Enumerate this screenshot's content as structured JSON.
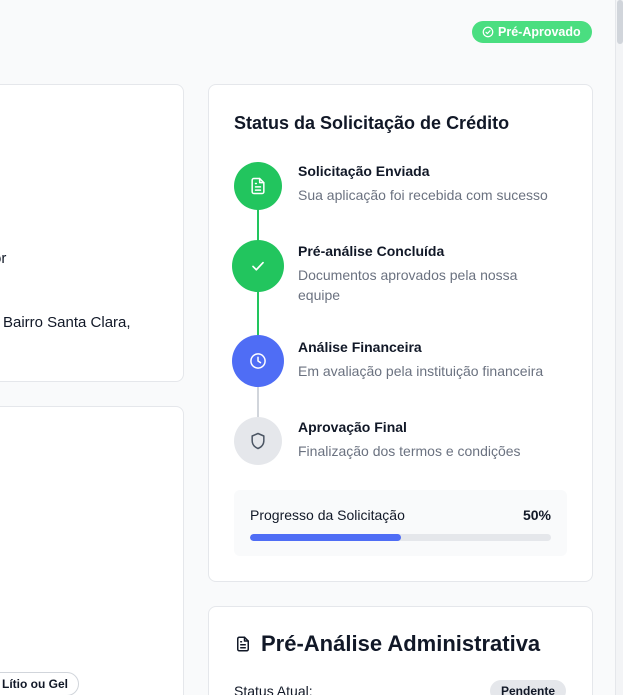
{
  "header": {
    "badge_label": "Pré-Aprovado"
  },
  "left_panel": {
    "fragment_1": "or",
    "fragment_2": "Bairro Santa Clara,",
    "chip_label": "Lítio ou Gel"
  },
  "status_card": {
    "title": "Status da Solicitação de Crédito",
    "steps": [
      {
        "title": "Solicitação Enviada",
        "description": "Sua aplicação foi recebida com sucesso",
        "state": "complete",
        "icon": "document-icon"
      },
      {
        "title": "Pré-análise Concluída",
        "description": "Documentos aprovados pela nossa equipe",
        "state": "complete",
        "icon": "check-icon"
      },
      {
        "title": "Análise Financeira",
        "description": "Em avaliação pela instituição financeira",
        "state": "current",
        "icon": "clock-icon"
      },
      {
        "title": "Aprovação Final",
        "description": "Finalização dos termos e condições",
        "state": "pending",
        "icon": "shield-icon"
      }
    ],
    "progress": {
      "label": "Progresso da Solicitação",
      "value_text": "50%",
      "fraction": 0.5
    }
  },
  "admin_card": {
    "title": "Pré-Análise Administrativa",
    "status_label": "Status Atual:",
    "status_badge": "Pendente"
  },
  "colors": {
    "success": "#22c55e",
    "badge_green": "#4ade80",
    "primary": "#4f6df5",
    "pending_gray": "#e5e7eb"
  }
}
